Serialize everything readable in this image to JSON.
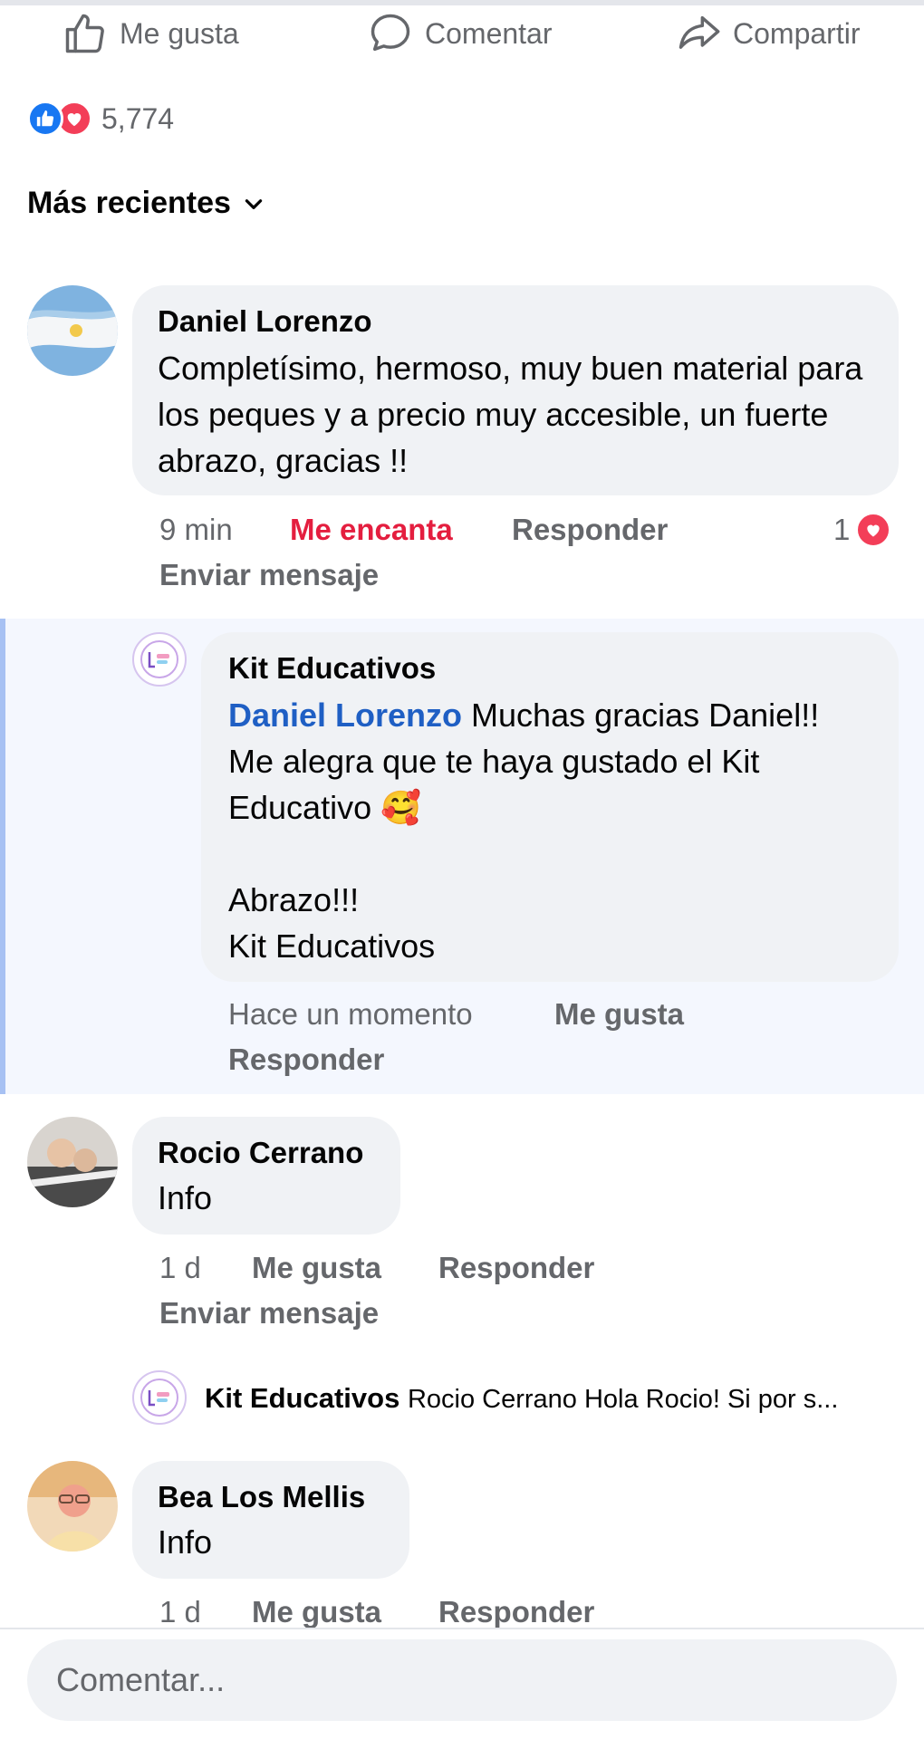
{
  "actions": {
    "like_label": "Me gusta",
    "comment_label": "Comentar",
    "share_label": "Compartir"
  },
  "reactions": {
    "count": "5,774",
    "icons": [
      "like-icon",
      "love-icon"
    ]
  },
  "sort": {
    "label": "Más recientes"
  },
  "comments": [
    {
      "author": "Daniel Lorenzo",
      "text": "Completísimo, hermoso, muy buen material para los peques y a precio muy accesible, un fuerte abrazo, gracias !!",
      "time": "9 min",
      "reaction_label": "Me encanta",
      "reply_label": "Responder",
      "message_label": "Enviar mensaje",
      "reaction_count": "1",
      "reply": {
        "author": "Kit Educativos",
        "mention": "Daniel Lorenzo",
        "text": " Muchas gracias Daniel!! Me alegra que te haya gustado el Kit Educativo 🥰\n\nAbrazo!!!\nKit Educativos",
        "time": "Hace un momento",
        "like_label": "Me gusta",
        "reply_label": "Responder"
      }
    },
    {
      "author": "Rocio Cerrano",
      "text": "Info",
      "time": "1 d",
      "like_label": "Me gusta",
      "reply_label": "Responder",
      "message_label": "Enviar mensaje",
      "reply_preview": {
        "author": "Kit Educativos",
        "text": "Rocio Cerrano Hola Rocio! Si por s..."
      }
    },
    {
      "author": "Bea Los Mellis",
      "text": "Info",
      "time": "1 d",
      "like_label": "Me gusta",
      "reply_label": "Responder"
    }
  ],
  "composer": {
    "placeholder": "Comentar..."
  },
  "colors": {
    "accent": "#1877f2",
    "love": "#e41e3f",
    "mention": "#1f5fc4",
    "bubble": "#f0f2f5",
    "secondary_text": "#65676b"
  }
}
